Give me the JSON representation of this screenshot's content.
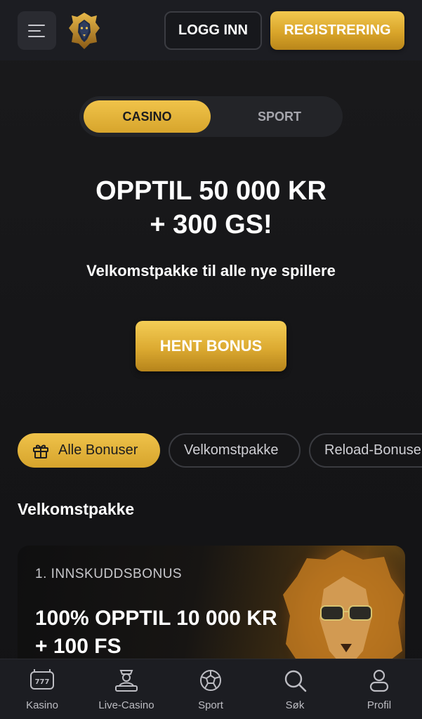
{
  "header": {
    "menu_icon": "menu-icon",
    "logo_icon": "lion-logo-icon",
    "login_label": "LOGG INN",
    "register_label": "REGISTRERING"
  },
  "toggle": {
    "casino_label": "CASINO",
    "sport_label": "SPORT",
    "active": "CASINO"
  },
  "hero": {
    "title_line1": "OPPTIL 50 000 KR",
    "title_line2": "+ 300 GS!",
    "subtitle": "Velkomstpakke til alle nye spillere",
    "cta_label": "HENT BONUS"
  },
  "filters": [
    {
      "label": "Alle Bonuser",
      "active": true,
      "icon": "gift-icon"
    },
    {
      "label": "Velkomstpakke",
      "active": false
    },
    {
      "label": "Reload-Bonuser",
      "active": false
    }
  ],
  "section": {
    "title": "Velkomstpakke"
  },
  "card": {
    "label": "1. INNSKUDDSBONUS",
    "title_line1": "100% OPPTIL 10 000 KR",
    "title_line2": "+ 100 FS"
  },
  "bottom_nav": [
    {
      "label": "Kasino",
      "icon": "slot-machine-icon"
    },
    {
      "label": "Live-Casino",
      "icon": "dealer-icon"
    },
    {
      "label": "Sport",
      "icon": "football-icon"
    },
    {
      "label": "Søk",
      "icon": "search-icon"
    },
    {
      "label": "Profil",
      "icon": "user-icon"
    }
  ],
  "colors": {
    "accent_gold": "#e0ad36",
    "background": "#151517",
    "header_bg": "#1c1d22"
  }
}
